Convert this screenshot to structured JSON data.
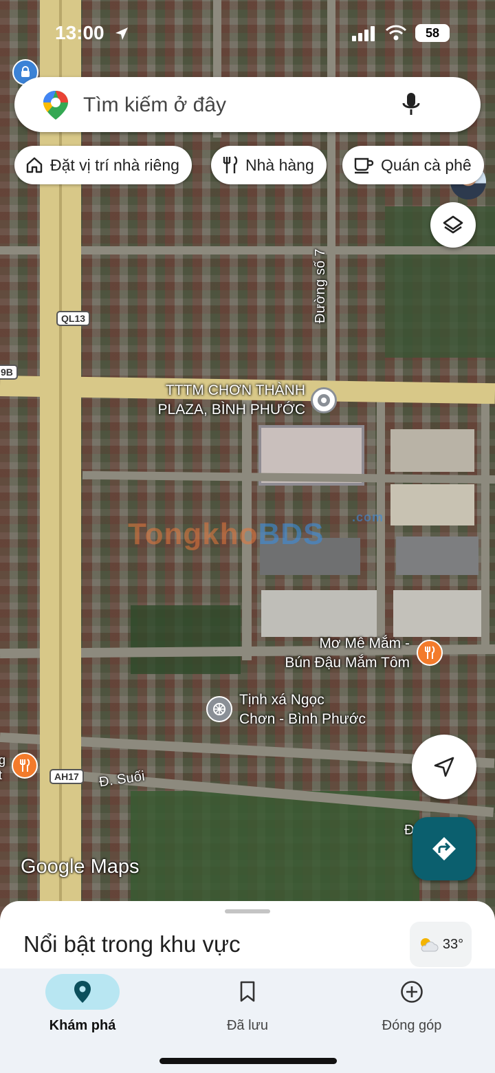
{
  "status_bar": {
    "time": "13:00",
    "battery": "58"
  },
  "search": {
    "placeholder": "Tìm kiếm ở đây"
  },
  "chips": [
    {
      "label": "Đặt vị trí nhà riêng",
      "icon": "home-icon"
    },
    {
      "label": "Nhà hàng",
      "icon": "restaurant-icon"
    },
    {
      "label": "Quán cà phê",
      "icon": "coffee-icon"
    }
  ],
  "map": {
    "road_labels": {
      "duong_so_7": "Đường số 7",
      "d_suoi": "Đ. Suối",
      "shield_ql13": "QL13",
      "shield_ah17": "AH17",
      "shield_9b": "9B",
      "edge_d": "Đ"
    },
    "places": {
      "plaza": {
        "line1": "TTTM CHƠN THÀNH",
        "line2": "PLAZA, BÌNH PHƯỚC"
      },
      "restaurant": {
        "line1": "Mơ Mê Mắm -",
        "line2": "Bún Đậu Mắm Tôm"
      },
      "temple": {
        "line1": "Tịnh xá Ngọc",
        "line2": "Chơn - Bình Phước"
      },
      "edge_left": {
        "line1": "g",
        "line2": "t"
      }
    },
    "watermark": {
      "part1": "Tongkho",
      "part2": "BDS",
      "suffix": ".com"
    },
    "attribution": "Google Maps"
  },
  "sheet": {
    "title": "Nổi bật trong khu vực",
    "weather": "33°"
  },
  "nav": [
    {
      "label": "Khám phá",
      "icon": "explore-pin-icon",
      "active": true
    },
    {
      "label": "Đã lưu",
      "icon": "bookmark-icon",
      "active": false
    },
    {
      "label": "Đóng góp",
      "icon": "add-circle-icon",
      "active": false
    }
  ],
  "colors": {
    "accent": "#0b5f6e",
    "nav_active_pill": "#b8e6f2",
    "road_major": "#d8c888"
  }
}
